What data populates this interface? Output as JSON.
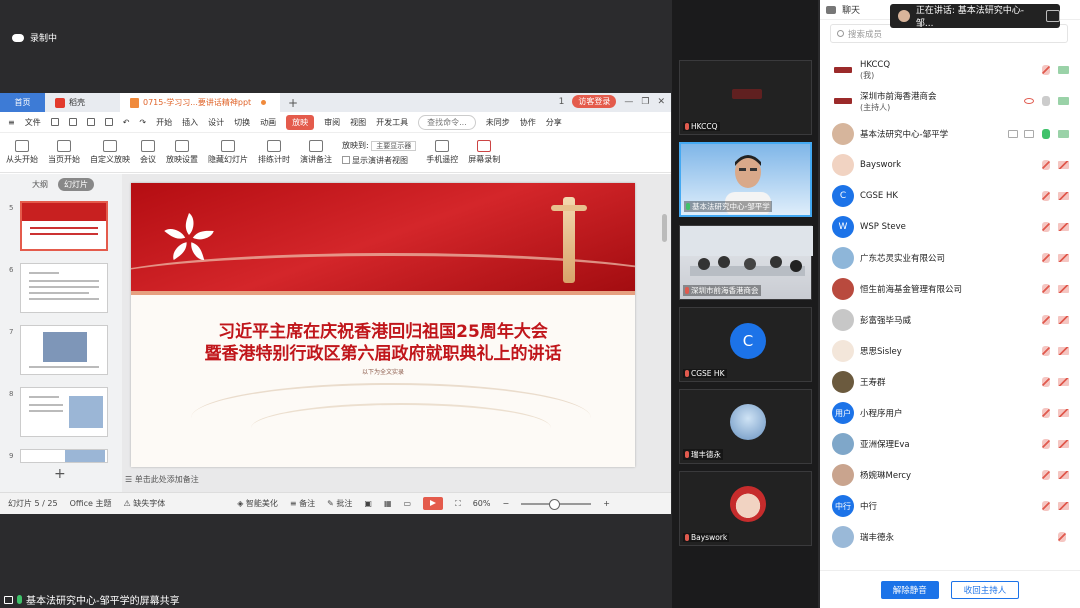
{
  "recording": {
    "label": "录制中"
  },
  "wps": {
    "tabs": [
      "首页",
      "稻壳",
      "0715-学习习...要讲话精神ppt"
    ],
    "visitor_label": "访客登录",
    "tab_badge": "1",
    "menu": [
      "文件",
      "开始",
      "插入",
      "设计",
      "切换",
      "动画",
      "放映",
      "审阅",
      "视图",
      "开发工具"
    ],
    "menu_active": "放映",
    "search_placeholder": "查找命令...",
    "menu_right": [
      "未同步",
      "协作",
      "分享"
    ],
    "ribbon": {
      "from_start": "从头开始",
      "from_current": "当页开始",
      "custom": "自定义放映",
      "meeting": "会议",
      "settings": "放映设置",
      "hide_slide": "隐藏幻灯片",
      "rehearse": "排练计时",
      "presenter_notes": "演讲备注",
      "show_to_label": "放映到:",
      "show_to_value": "主要显示器",
      "show_presenter_view": "显示演讲者视图",
      "phone_remote": "手机遥控",
      "screen_record": "屏幕录制"
    },
    "thumb_tabs": [
      "大纲",
      "幻灯片"
    ],
    "thumb_numbers": [
      "5",
      "6",
      "7",
      "8",
      "9"
    ],
    "slide": {
      "title_line1": "习近平主席在庆祝香港回归祖国25周年大会",
      "title_line2": "暨香港特别行政区第六届政府就职典礼上的讲话",
      "subtitle": "以下为全文实录"
    },
    "notes_hint": "单击此处添加备注",
    "status": {
      "slide_count": "幻灯片 5 / 25",
      "theme": "Office 主题",
      "missing_font": "缺失字体",
      "beautify": "智能美化",
      "notes": "备注",
      "comments": "批注",
      "zoom": "60%"
    }
  },
  "share_bar": {
    "label": "基本法研究中心-邹平学的屏幕共享"
  },
  "video_tiles": [
    {
      "name": "HKCCQ",
      "kind": "logo",
      "mic": "off"
    },
    {
      "name": "基本法研究中心-邹平学",
      "kind": "person",
      "mic": "on"
    },
    {
      "name": "深圳市前海香港商会",
      "kind": "room",
      "mic": "off"
    },
    {
      "name": "CGSE HK",
      "kind": "letter",
      "letter": "C",
      "mic": "off"
    },
    {
      "name": "瑞丰德永",
      "kind": "photo",
      "mic": "off"
    },
    {
      "name": "Bayswork",
      "kind": "cartoon",
      "mic": "off"
    }
  ],
  "panel": {
    "title": "聊天",
    "speaking": "正在讲话: 基本法研究中心-邹...",
    "search_placeholder": "搜索成员",
    "participants": [
      {
        "name": "HKCCQ",
        "sub": "(我)",
        "avatar": "logo",
        "mic": "off",
        "cam": "on"
      },
      {
        "name": "深圳市前海香港商会",
        "sub": "(主持人)",
        "avatar": "logo",
        "mic": "off-grey",
        "cam": "on",
        "eye": true
      },
      {
        "name": "基本法研究中心-邹平学",
        "sub": "",
        "avatar": "photo",
        "mic": "on",
        "cam": "on",
        "share": true
      },
      {
        "name": "Bayswork",
        "sub": "",
        "avatar": "cartoon",
        "mic": "off",
        "cam": "on"
      },
      {
        "name": "CGSE HK",
        "sub": "",
        "avatar": "C",
        "mic": "off",
        "cam": "on"
      },
      {
        "name": "WSP Steve",
        "sub": "",
        "avatar": "W",
        "mic": "off",
        "cam": "on"
      },
      {
        "name": "广东芯灵实业有限公司",
        "sub": "",
        "avatar": "photo",
        "mic": "off",
        "cam": "on"
      },
      {
        "name": "恒生前海基金管理有限公司",
        "sub": "",
        "avatar": "photo",
        "mic": "off",
        "cam": "on"
      },
      {
        "name": "彭富强毕马威",
        "sub": "",
        "avatar": "photo",
        "mic": "off",
        "cam": "on"
      },
      {
        "name": "思思Sisley",
        "sub": "",
        "avatar": "photo",
        "mic": "off",
        "cam": "on"
      },
      {
        "name": "王寿群",
        "sub": "",
        "avatar": "photo",
        "mic": "off",
        "cam": "on"
      },
      {
        "name": "小程序用户",
        "sub": "",
        "avatar": "用户",
        "mic": "off",
        "cam": "on"
      },
      {
        "name": "亚洲保理Eva",
        "sub": "",
        "avatar": "photo",
        "mic": "off",
        "cam": "on"
      },
      {
        "name": "杨婉琳Mercy",
        "sub": "",
        "avatar": "photo",
        "mic": "off",
        "cam": "on"
      },
      {
        "name": "中行",
        "sub": "",
        "avatar": "中行",
        "mic": "off",
        "cam": "on"
      },
      {
        "name": "瑞丰德永",
        "sub": "",
        "avatar": "photo",
        "mic": "off",
        "cam": "none"
      }
    ],
    "unmute_all": "解除静音",
    "reclaim_host": "收回主持人"
  },
  "colors": {
    "accent": "#1c73e8",
    "wps_red": "#e45b4c",
    "mic_on": "#3fc26a",
    "mic_off": "#e05a4e"
  }
}
